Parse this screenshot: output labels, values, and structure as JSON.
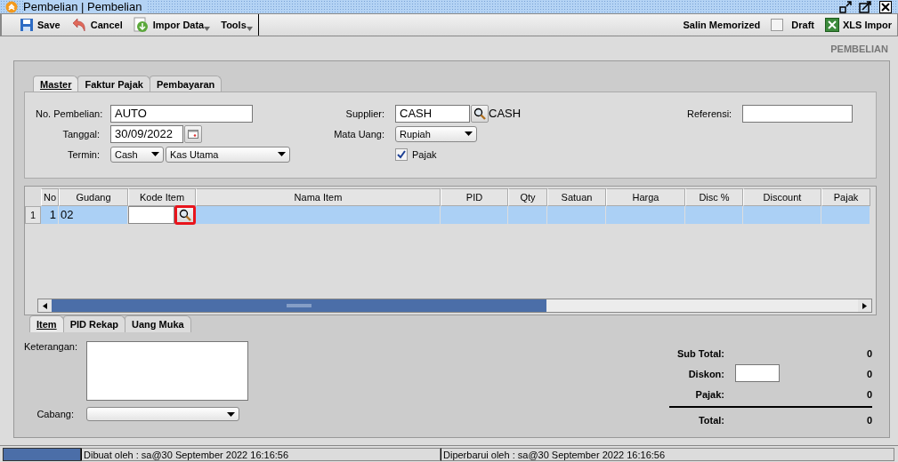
{
  "window": {
    "title": "Pembelian | Pembelian"
  },
  "toolbar": {
    "left": [
      {
        "label": "Save",
        "kind": "save"
      },
      {
        "label": "Cancel",
        "kind": "cancel"
      },
      {
        "label": "Impor Data",
        "kind": "import"
      },
      {
        "label": "Tools",
        "kind": "menu"
      }
    ],
    "copy_memorized": "Salin Memorized",
    "draft": {
      "label": "Draft",
      "checked": false
    },
    "xls_import": "XLS Impor"
  },
  "page_heading": "PEMBELIAN",
  "tabs": [
    {
      "label": "Master",
      "selected": true
    },
    {
      "label": "Faktur Pajak",
      "selected": false
    },
    {
      "label": "Pembayaran",
      "selected": false
    }
  ],
  "master": {
    "number": {
      "label": "No. Pembelian:",
      "value": "AUTO"
    },
    "date": {
      "label": "Tanggal:",
      "value": "30/09/2022"
    },
    "term": {
      "label": "Termin:",
      "value": "Cash",
      "account": "Kas Utama"
    },
    "supplier": {
      "label": "Supplier:",
      "value": "CASH",
      "name": "CASH"
    },
    "currency": {
      "label": "Mata Uang:",
      "value": "Rupiah"
    },
    "tax": {
      "label": "Pajak",
      "checked": true
    },
    "reference": {
      "label": "Referensi:"
    }
  },
  "table": {
    "columns": [
      "No",
      "Gudang",
      "Kode Item",
      "Nama Item",
      "PID",
      "Qty",
      "Satuan",
      "Harga",
      "Disc %",
      "Discount",
      "Pajak"
    ],
    "rows": [
      {
        "row_header": "1",
        "no": "1",
        "warehouse": "02",
        "selected": true,
        "lookup_highlighted": true
      }
    ]
  },
  "bottom_tabs": [
    {
      "label": "Item",
      "selected": true
    },
    {
      "label": "PID Rekap",
      "selected": false
    },
    {
      "label": "Uang Muka",
      "selected": false
    }
  ],
  "notes": {
    "label": "Keterangan:"
  },
  "branch": {
    "label": "Cabang:"
  },
  "totals": [
    {
      "label": "Sub Total:",
      "value": "0",
      "kind": "plain"
    },
    {
      "label": "Diskon:",
      "value": "0",
      "kind": "input"
    },
    {
      "label": "Pajak:",
      "value": "0",
      "kind": "plain"
    },
    {
      "label": "Total:",
      "value": "0",
      "kind": "total"
    }
  ],
  "status_bar": {
    "created": "Dibuat oleh : sa@30 September 2022  16:16:56",
    "updated": "Diperbarui oleh : sa@30 September 2022  16:16:56"
  }
}
